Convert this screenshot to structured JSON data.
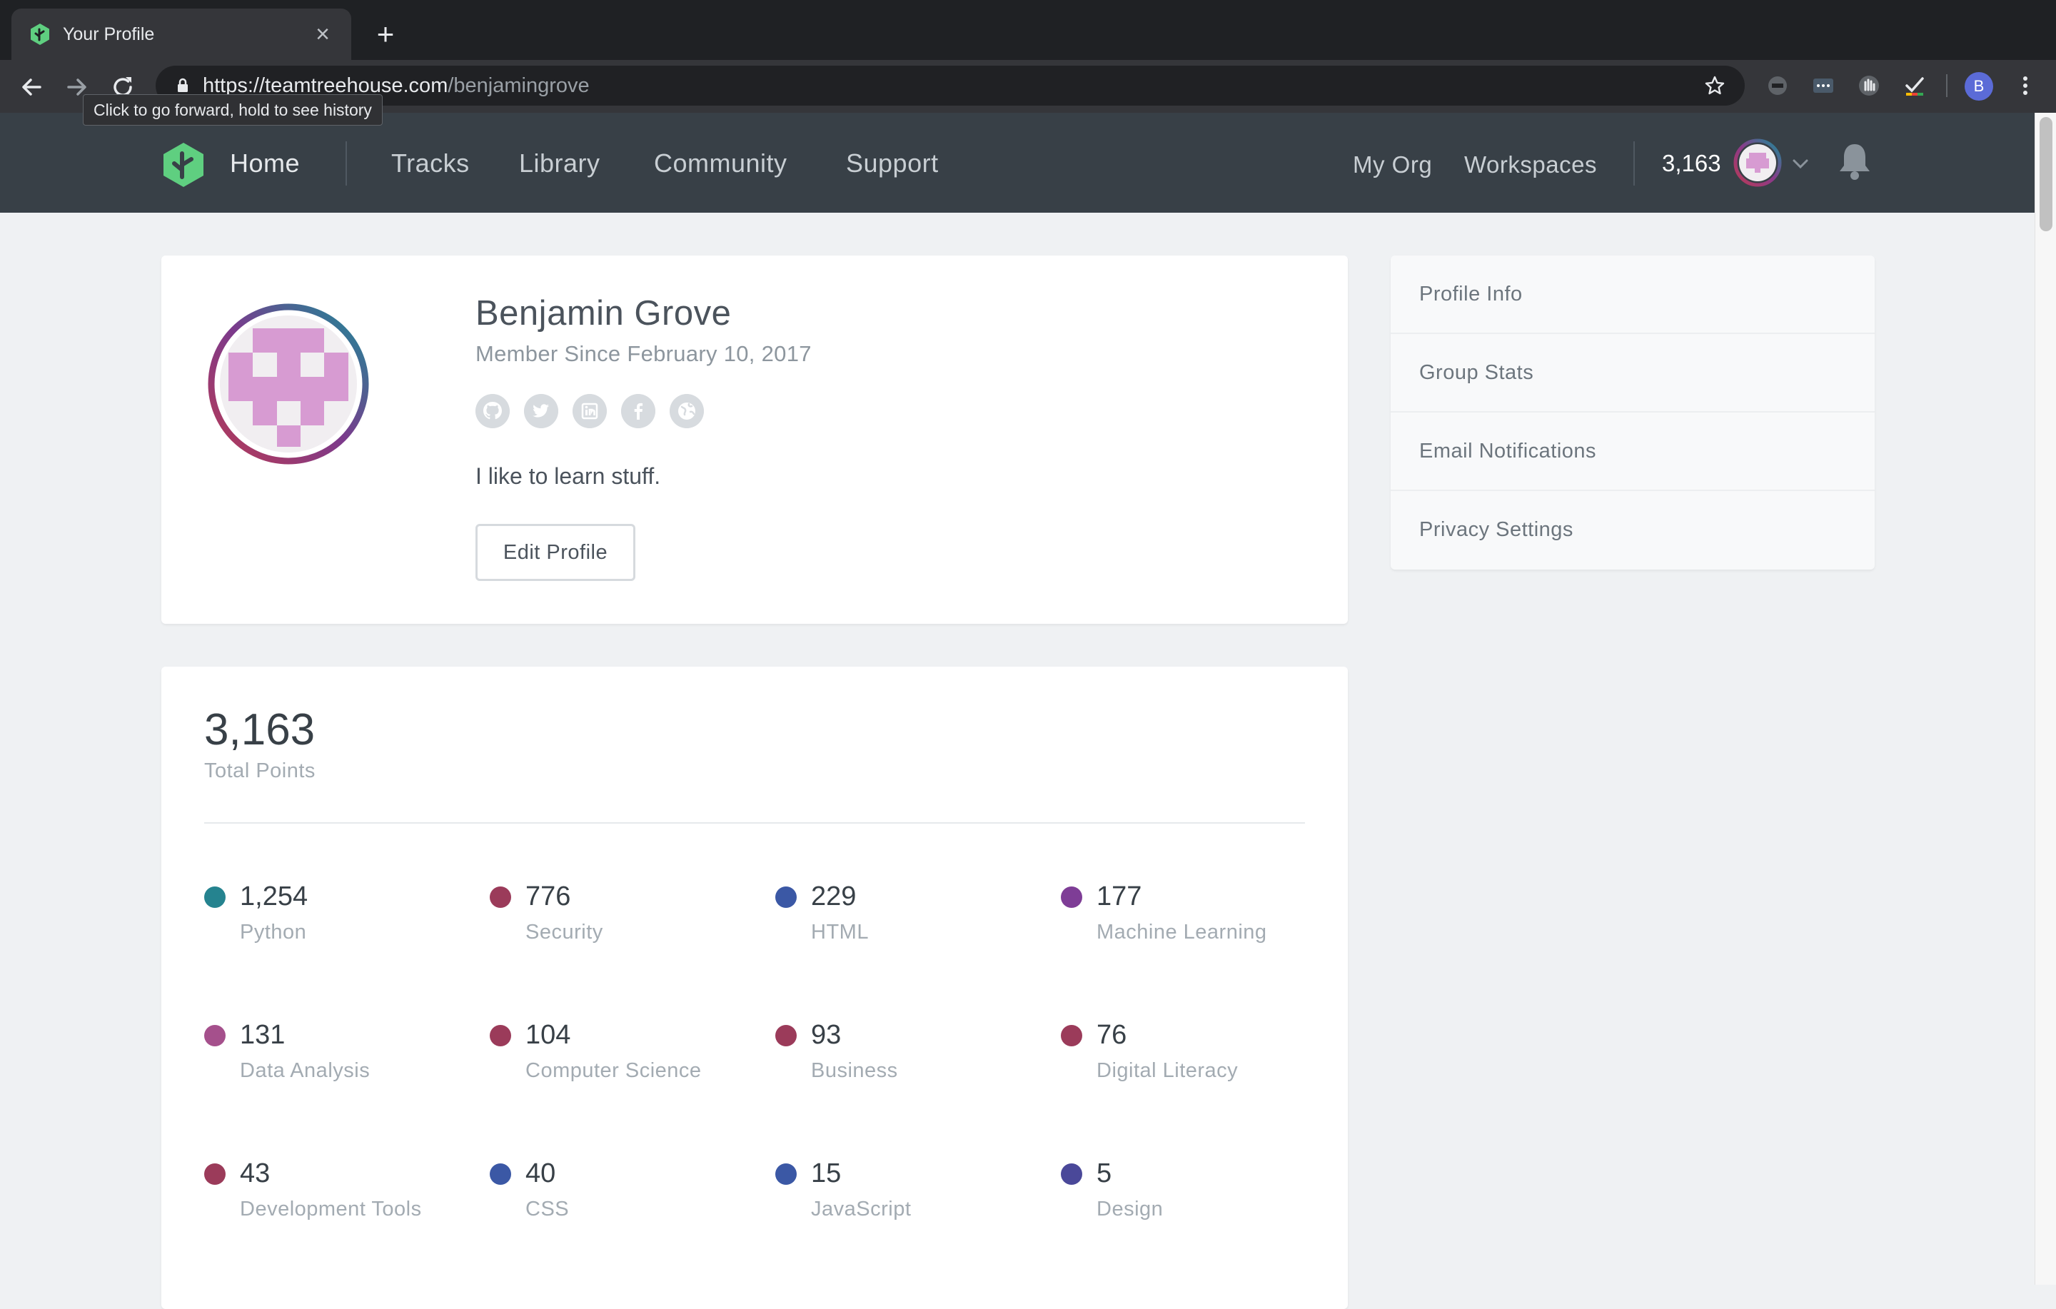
{
  "browser": {
    "tab_title": "Your Profile",
    "url_scheme": "https://",
    "url_host": "teamtreehouse.com",
    "url_path": "/benjamingrove",
    "tooltip": "Click to go forward, hold to see history",
    "profile_initial": "B"
  },
  "header": {
    "home": "Home",
    "nav": [
      "Tracks",
      "Library",
      "Community",
      "Support"
    ],
    "my_org": "My Org",
    "workspaces": "Workspaces",
    "points": "3,163"
  },
  "profile": {
    "name": "Benjamin Grove",
    "member_since": "Member Since February 10, 2017",
    "social_icons": [
      "github-icon",
      "twitter-icon",
      "linkedin-icon",
      "facebook-icon",
      "website-icon"
    ],
    "bio": "I like to learn stuff.",
    "edit_label": "Edit Profile"
  },
  "side_menu": [
    "Profile Info",
    "Group Stats",
    "Email Notifications",
    "Privacy Settings"
  ],
  "points": {
    "total": "3,163",
    "total_label": "Total Points",
    "topics": [
      {
        "value": "1,254",
        "label": "Python",
        "color": "#25838f"
      },
      {
        "value": "776",
        "label": "Security",
        "color": "#9b3b5a"
      },
      {
        "value": "229",
        "label": "HTML",
        "color": "#3b58a5"
      },
      {
        "value": "177",
        "label": "Machine Learning",
        "color": "#7e3d96"
      },
      {
        "value": "131",
        "label": "Data Analysis",
        "color": "#a5508c"
      },
      {
        "value": "104",
        "label": "Computer Science",
        "color": "#9b3b5a"
      },
      {
        "value": "93",
        "label": "Business",
        "color": "#9b3b5a"
      },
      {
        "value": "76",
        "label": "Digital Literacy",
        "color": "#9b3b5a"
      },
      {
        "value": "43",
        "label": "Development Tools",
        "color": "#9b3b5a"
      },
      {
        "value": "40",
        "label": "CSS",
        "color": "#3b58a5"
      },
      {
        "value": "15",
        "label": "JavaScript",
        "color": "#3b58a5"
      },
      {
        "value": "5",
        "label": "Design",
        "color": "#4a4899"
      }
    ]
  },
  "colors": {
    "header_bg": "#384047",
    "treehouse_green": "#5fcf80",
    "page_bg": "#eff1f3"
  }
}
